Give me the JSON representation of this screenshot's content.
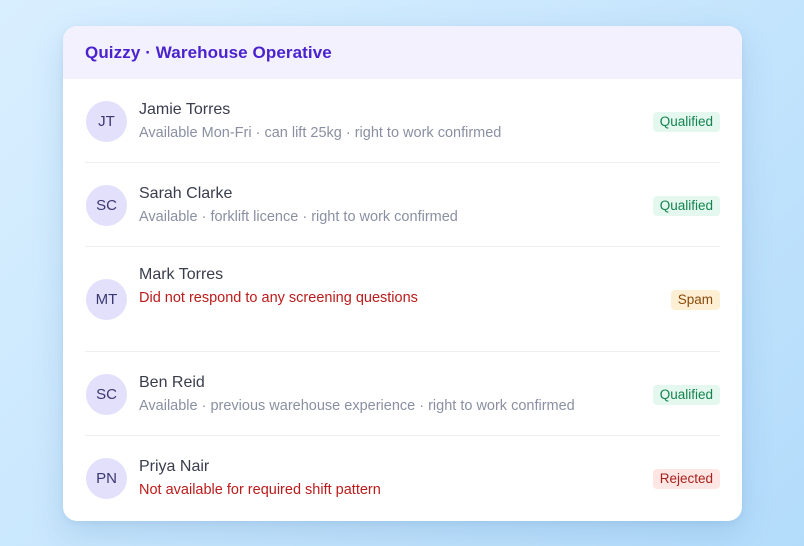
{
  "card": {
    "title": "Quizzy · Warehouse Operative"
  },
  "candidates": [
    {
      "initials": "JT",
      "name": "Jamie Torres",
      "detail": "Available Mon-Fri · can lift 25kg · right to work confirmed",
      "status": "Qualified"
    },
    {
      "initials": "SC",
      "name": "Sarah Clarke",
      "detail": "Available · forklift licence · right to work confirmed",
      "status": "Qualified"
    },
    {
      "initials": "MT",
      "name": "Mark Torres",
      "detail": "Did not respond to any screening questions",
      "status": "Spam"
    },
    {
      "initials": "SC",
      "name": "Ben Reid",
      "detail": "Available · previous warehouse experience · right to work confirmed",
      "status": "Qualified"
    },
    {
      "initials": "PN",
      "name": "Priya Nair",
      "detail": "Not available for required shift pattern",
      "status": "Rejected"
    }
  ],
  "colors": {
    "title": "#4a22cf",
    "qualified": "#14834f",
    "spam": "#8a4b0d",
    "rejected": "#a8211c",
    "alert_text": "#bc1b1b"
  }
}
